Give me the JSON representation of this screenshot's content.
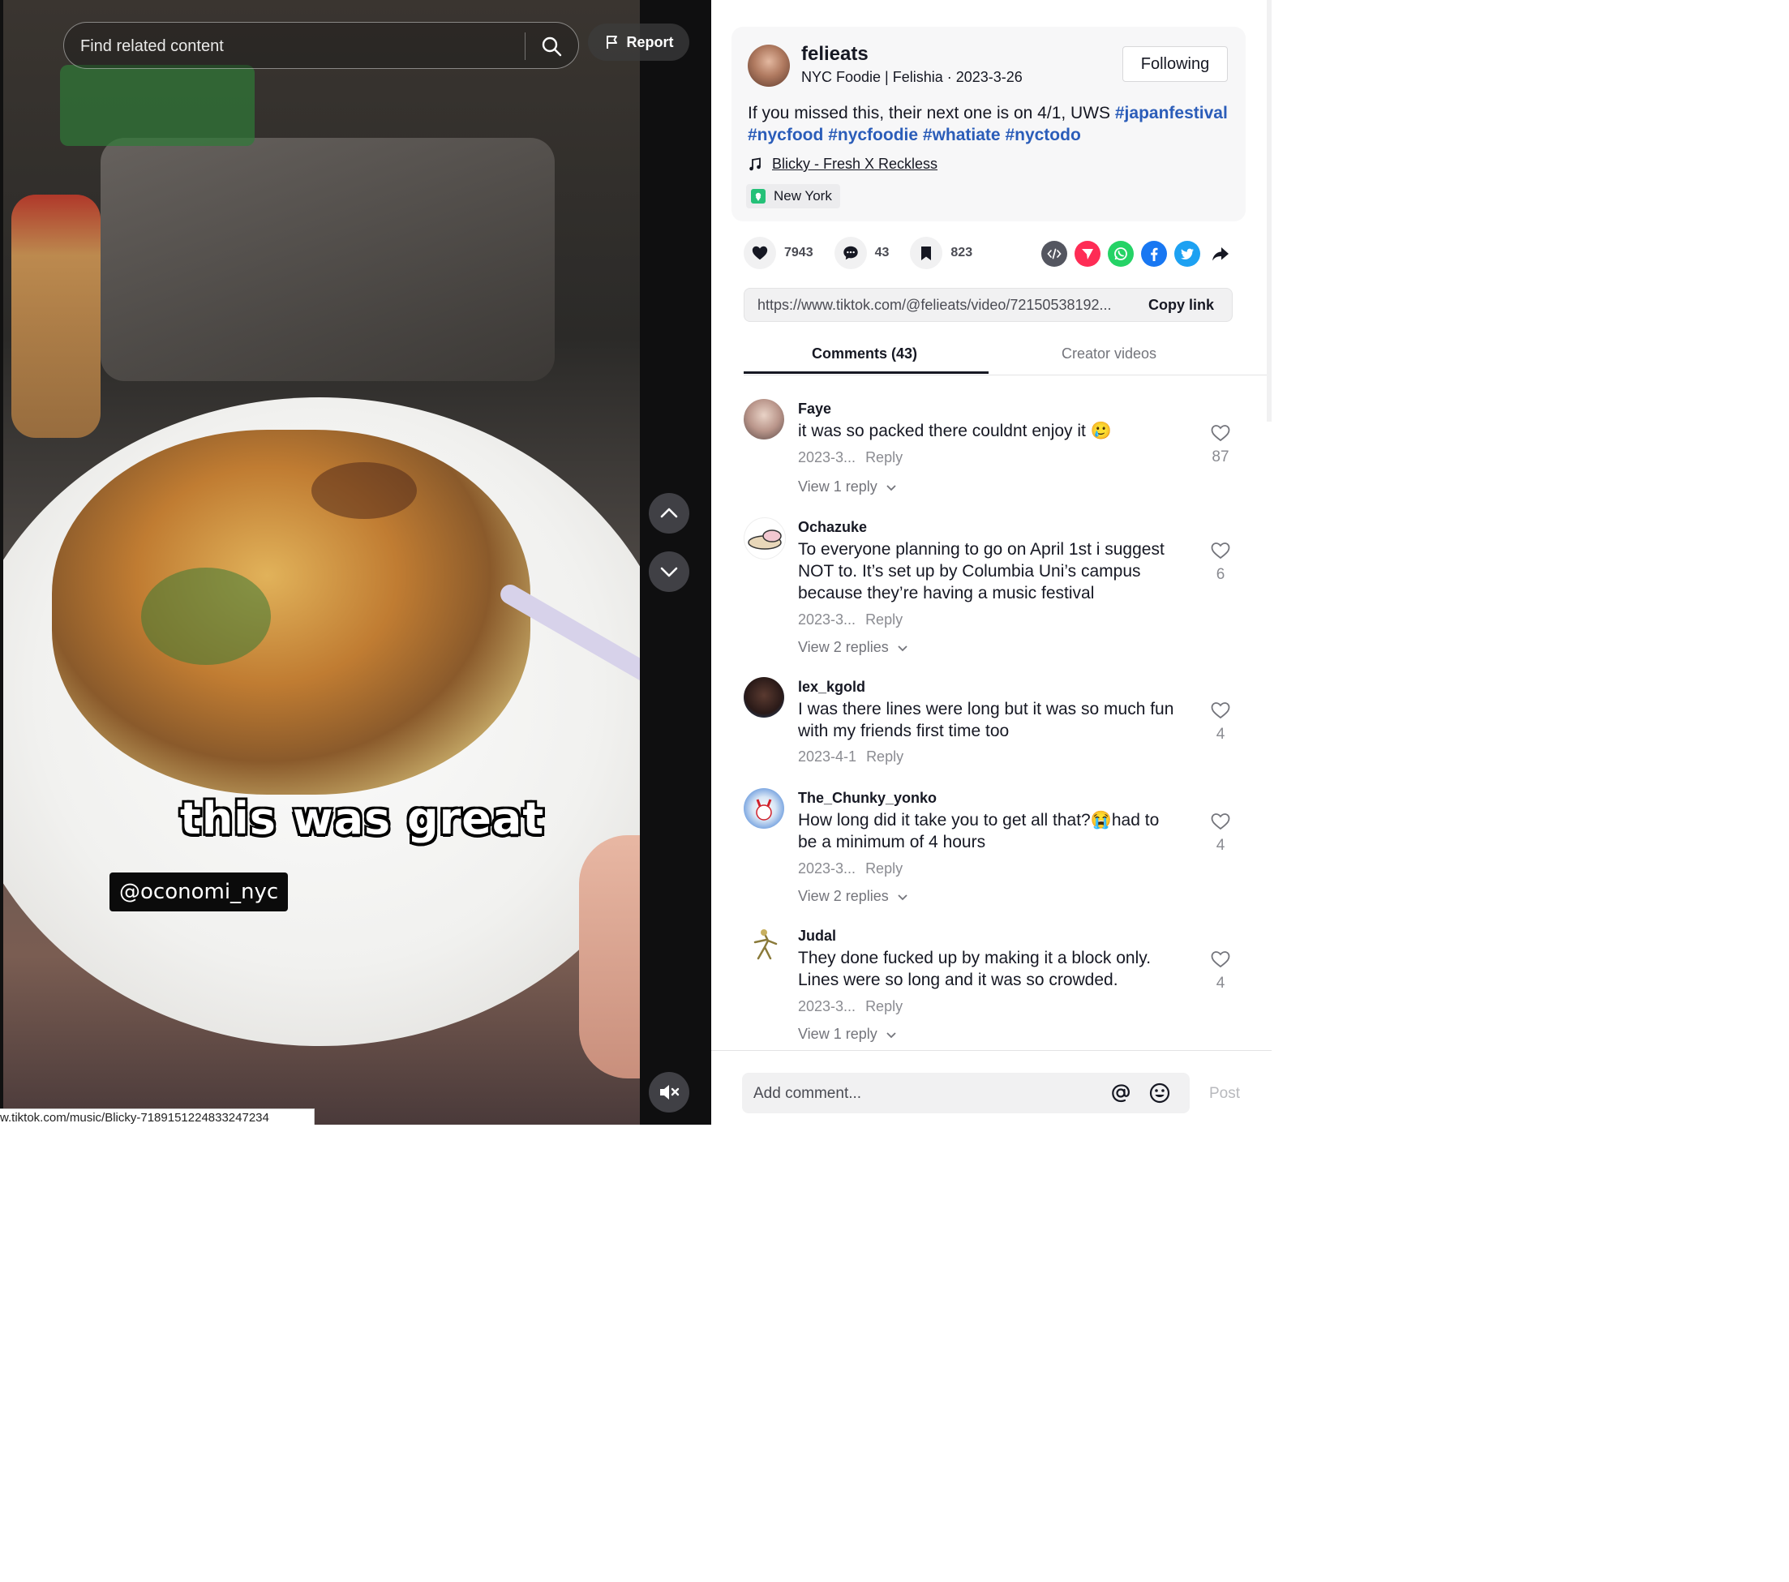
{
  "video": {
    "search_placeholder": "Find related content",
    "report_label": "Report",
    "overlay_caption": "this was great",
    "overlay_tag": "@oconomi_nyc",
    "status_url": "w.tiktok.com/music/Blicky-7189151224833247234"
  },
  "author": {
    "username": "felieats",
    "subtitle": "NYC Foodie | Felishia · 2023-3-26",
    "follow_label": "Following"
  },
  "post": {
    "desc_text": "If you missed this, their next one is on 4/1, UWS ",
    "hashtags": [
      "#japanfestival",
      "#nycfood",
      "#nycfoodie",
      "#whatiate",
      "#nyctodo"
    ],
    "music": "Blicky - Fresh X Reckless",
    "location": "New York"
  },
  "stats": {
    "likes": "7943",
    "comments": "43",
    "saves": "823"
  },
  "share_icons": [
    "embed-icon",
    "send-to-friends-icon",
    "whatsapp-icon",
    "facebook-icon",
    "twitter-icon",
    "share-arrow-icon"
  ],
  "link": {
    "url": "https://www.tiktok.com/@felieats/video/72150538192...",
    "copy_label": "Copy link"
  },
  "tabs": {
    "comments": "Comments (43)",
    "creator_videos": "Creator videos"
  },
  "comments": [
    {
      "user": "Faye",
      "text": "it was so packed there couldnt enjoy it 🥲",
      "date": "2023-3...",
      "reply": "Reply",
      "view": "View 1 reply",
      "likes": "87"
    },
    {
      "user": "Ochazuke",
      "text": "To everyone planning to go on April 1st i suggest NOT to. It’s set up by Columbia Uni’s campus because they’re having a music festival",
      "date": "2023-3...",
      "reply": "Reply",
      "view": "View 2 replies",
      "likes": "6"
    },
    {
      "user": "lex_kgold",
      "text": "I was there lines were long but it was so much fun with my friends first time too",
      "date": "2023-4-1",
      "reply": "Reply",
      "view": "",
      "likes": "4"
    },
    {
      "user": "The_Chunky_yonko",
      "text": "How long did it take you to get all that?😭had to be a minimum of 4 hours",
      "date": "2023-3...",
      "reply": "Reply",
      "view": "View 2 replies",
      "likes": "4"
    },
    {
      "user": "Judal",
      "text": "They done fucked up by making it a block only. Lines were so long and it was so crowded.",
      "date": "2023-3...",
      "reply": "Reply",
      "view": "View 1 reply",
      "likes": "4"
    }
  ],
  "composer": {
    "placeholder": "Add comment...",
    "post_label": "Post"
  },
  "colors": {
    "hashtag": "#2b5db9",
    "like": "#161823",
    "whatsapp": "#25d366",
    "facebook": "#1877f2",
    "twitter": "#1da1f2",
    "send": "#fe2c55"
  }
}
